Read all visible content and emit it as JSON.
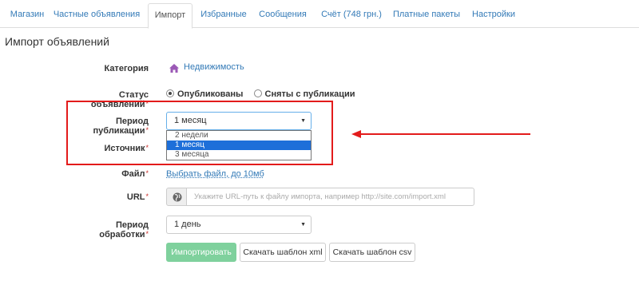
{
  "tabs": [
    {
      "label": "Магазин"
    },
    {
      "label": "Частные объявления"
    },
    {
      "label": "Импорт"
    },
    {
      "label": "Избранные"
    },
    {
      "label": "Сообщения"
    },
    {
      "label": "Счёт (748 грн.)"
    },
    {
      "label": "Платные пакеты"
    },
    {
      "label": "Настройки"
    }
  ],
  "active_tab": "Импорт",
  "page_title": "Импорт объявлений",
  "form": {
    "category": {
      "label": "Категория",
      "value": "Недвижимость",
      "icon": "house-icon"
    },
    "status": {
      "label": "Статус объявлений",
      "required": "*",
      "options": [
        "Опубликованы",
        "Сняты с публикации"
      ],
      "selected": "Опубликованы"
    },
    "period": {
      "label": "Период публикации",
      "required": "*",
      "value": "1 месяц",
      "options": [
        "2 недели",
        "1 месяц",
        "3 месяца"
      ],
      "selected": "1 месяц"
    },
    "source": {
      "label": "Источник",
      "required": "*"
    },
    "file": {
      "label": "Файл",
      "required": "*",
      "link": "Выбрать файл, до 10мб"
    },
    "url": {
      "label": "URL",
      "required": "*",
      "placeholder": "Укажите URL-путь к файлу импорта, например http://site.com/import.xml",
      "icon": "globe-icon"
    },
    "processing": {
      "label": "Период обработки",
      "required": "*",
      "value": "1 день"
    }
  },
  "buttons": {
    "import": "Импортировать",
    "template_xml": "Скачать шаблон xml",
    "template_csv": "Скачать шаблон csv"
  },
  "colors": {
    "link": "#337ab7",
    "annotation": "#e31b1b",
    "primary_button": "#7fd19d",
    "selected_option": "#1e6fd9"
  }
}
